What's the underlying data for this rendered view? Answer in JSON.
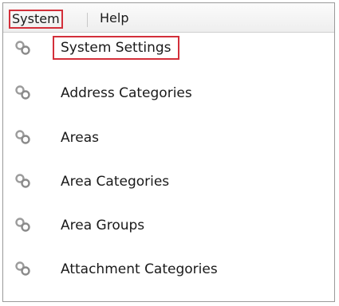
{
  "menubar": {
    "items": [
      {
        "label": "System"
      },
      {
        "label": "Help"
      }
    ]
  },
  "menu": {
    "items": [
      {
        "label": "System Settings",
        "icon": "gears-icon"
      },
      {
        "label": "Address Categories",
        "icon": "gears-icon"
      },
      {
        "label": "Areas",
        "icon": "gears-icon"
      },
      {
        "label": "Area Categories",
        "icon": "gears-icon"
      },
      {
        "label": "Area Groups",
        "icon": "gears-icon"
      },
      {
        "label": "Attachment Categories",
        "icon": "gears-icon"
      }
    ]
  },
  "colors": {
    "highlight": "#d32f3a",
    "icon_gray": "#9c9c9c"
  }
}
